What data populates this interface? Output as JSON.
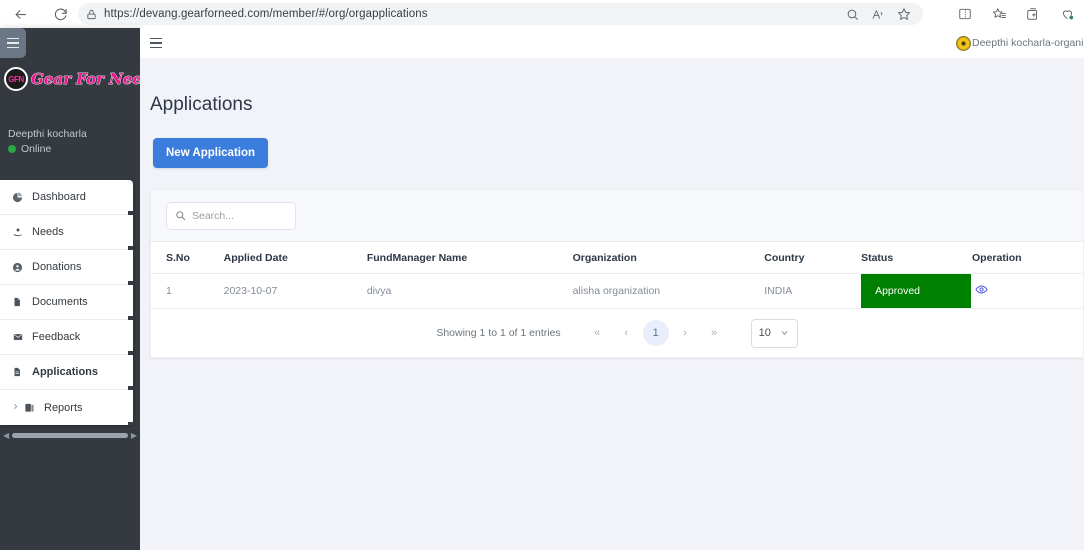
{
  "browser": {
    "url": "https://devang.gearforneed.com/member/#/org/orgapplications",
    "back_icon": "back-arrow-icon",
    "reload_icon": "reload-icon",
    "lock_icon": "lock-icon",
    "omnibox_icons": [
      "search-icon",
      "read-aloud-icon",
      "favorite-star-icon"
    ],
    "toolbar_icons": [
      "split-screen-icon",
      "collections-favorites-icon",
      "collections-icon",
      "browser-essentials-icon"
    ]
  },
  "sidebar": {
    "toggle_label": "menu-toggle",
    "brand": {
      "mark": "GFN",
      "text": "Gear For Need"
    },
    "user": {
      "name": "Deepthi kocharla",
      "status": "Online"
    },
    "items": [
      {
        "label": "Dashboard",
        "icon": "dashboard-pie-icon",
        "active": false,
        "caret": false
      },
      {
        "label": "Needs",
        "icon": "needs-hand-icon",
        "active": false,
        "caret": false
      },
      {
        "label": "Donations",
        "icon": "donations-icon",
        "active": false,
        "caret": false
      },
      {
        "label": "Documents",
        "icon": "document-icon",
        "active": false,
        "caret": false
      },
      {
        "label": "Feedback",
        "icon": "envelope-icon",
        "active": false,
        "caret": false
      },
      {
        "label": "Applications",
        "icon": "application-file-icon",
        "active": true,
        "caret": false
      },
      {
        "label": "Reports",
        "icon": "reports-book-icon",
        "active": false,
        "caret": true
      }
    ]
  },
  "topbar": {
    "hamburger": "hamburger-icon",
    "avatar": "sunflower-avatar",
    "username": "Deepthi kocharla-organisation"
  },
  "main": {
    "page_title": "Applications",
    "new_application_label": "New Application",
    "search": {
      "placeholder": "Search...",
      "value": ""
    },
    "table": {
      "columns": [
        "S.No",
        "Applied Date",
        "FundManager Name",
        "Organization",
        "Country",
        "Status",
        "Operation"
      ],
      "rows": [
        {
          "sno": "1",
          "applied_date": "2023-10-07",
          "fundmanager_name": "divya",
          "organization": "alisha organization",
          "country": "INDIA",
          "status": "Approved",
          "operation_icon": "view-eye-icon"
        }
      ]
    },
    "pagination": {
      "showing": "Showing 1 to 1 of 1 entries",
      "first_label": "«",
      "prev_label": "‹",
      "current_page": "1",
      "next_label": "›",
      "last_label": "»",
      "page_size": "10"
    }
  },
  "colors": {
    "sidebar_bg": "#343a40",
    "content_bg": "#f2f3f8",
    "primary_button": "#3b7ddd",
    "status_approved": "#008000",
    "brand_pink": "#e8188f",
    "online_green": "#28a745",
    "eye_icon": "#4c5ce0"
  }
}
